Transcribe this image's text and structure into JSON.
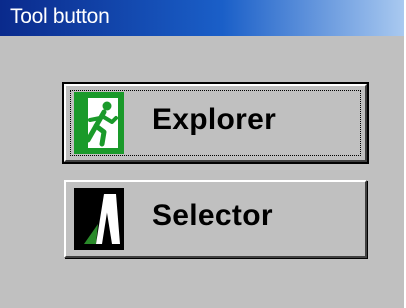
{
  "window": {
    "title": "Tool button",
    "colors": {
      "titlebar_start": "#0a2a8c",
      "titlebar_end": "#a9c9f0",
      "face": "#c0c0c0"
    }
  },
  "buttons": [
    {
      "label": "Explorer",
      "icon": "running-man-exit-icon",
      "icon_color": "#1a9a2a",
      "focused": true
    },
    {
      "label": "Selector",
      "icon": "selector-wedge-icon",
      "icon_color": "#2a8a2a",
      "focused": false
    }
  ]
}
